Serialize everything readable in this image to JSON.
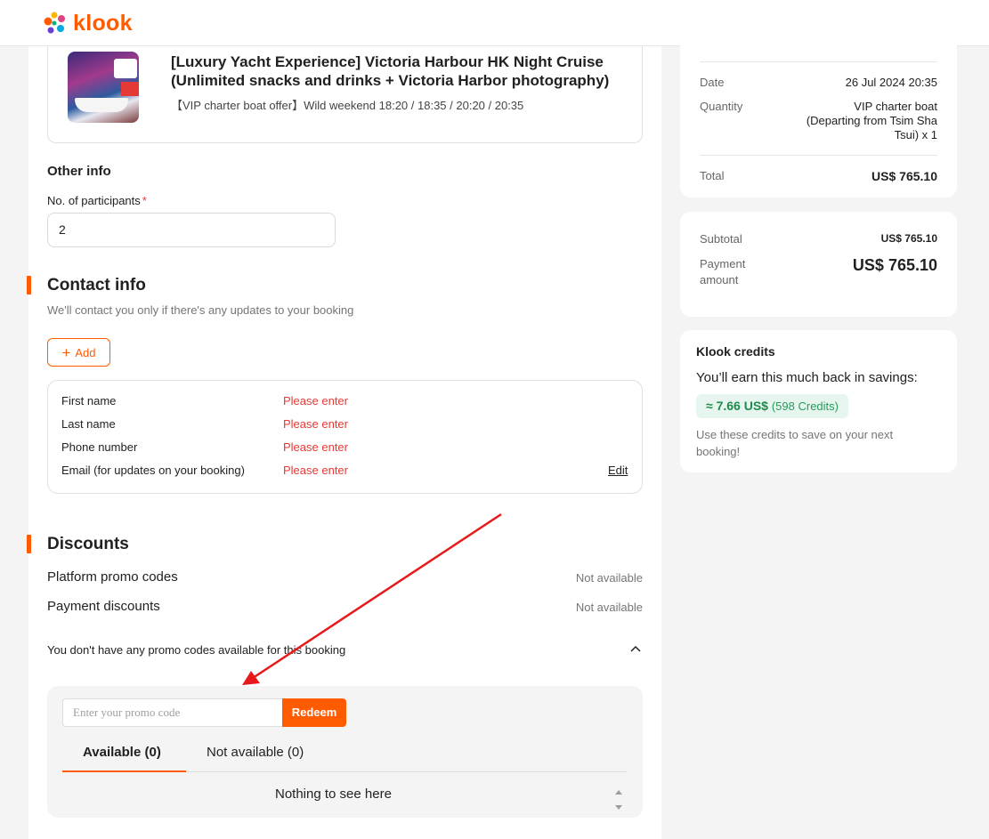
{
  "brand": {
    "name": "klook",
    "accent": "#ff5b00"
  },
  "product": {
    "title": "[Luxury Yacht Experience] Victoria Harbour HK Night Cruise (Unlimited snacks and drinks + Victoria Harbor photography)",
    "package": "【VIP charter boat offer】Wild weekend 18:20 / 18:35 / 20:20 / 20:35"
  },
  "other_info": {
    "title": "Other info",
    "participants_label": "No. of participants",
    "required_mark": "*",
    "participants_value": "2"
  },
  "contact": {
    "title": "Contact info",
    "subtitle": "We'll contact you only if there's any updates to your booking",
    "add_label": "Add",
    "rows": [
      {
        "label": "First name",
        "value": "Please enter"
      },
      {
        "label": "Last name",
        "value": "Please enter"
      },
      {
        "label": "Phone number",
        "value": "Please enter"
      },
      {
        "label": "Email (for updates on your booking)",
        "value": "Please enter"
      }
    ],
    "edit_label": "Edit"
  },
  "discounts": {
    "title": "Discounts",
    "platform_label": "Platform promo codes",
    "platform_value": "Not available",
    "payment_label": "Payment discounts",
    "payment_value": "Not available",
    "note": "You don't have any promo codes available for this booking",
    "promo_placeholder": "Enter your promo code",
    "redeem_label": "Redeem",
    "tab_available": "Available (0)",
    "tab_unavailable": "Not available (0)",
    "empty_text": "Nothing to see here"
  },
  "summary": {
    "date_label": "Date",
    "date_value": "26 Jul 2024 20:35",
    "quantity_label": "Quantity",
    "quantity_value": "VIP charter boat (Departing from Tsim Sha Tsui) x 1",
    "total_label": "Total",
    "total_value": "US$ 765.10"
  },
  "payment": {
    "subtotal_label": "Subtotal",
    "subtotal_value": "US$ 765.10",
    "amount_label": "Payment amount",
    "amount_value": "US$ 765.10"
  },
  "credits": {
    "title": "Klook credits",
    "subtitle": "You’ll earn this much back in savings:",
    "amount": "≈ 7.66 US$",
    "count": "(598 Credits)",
    "note": "Use these credits to save on your next booking!"
  }
}
